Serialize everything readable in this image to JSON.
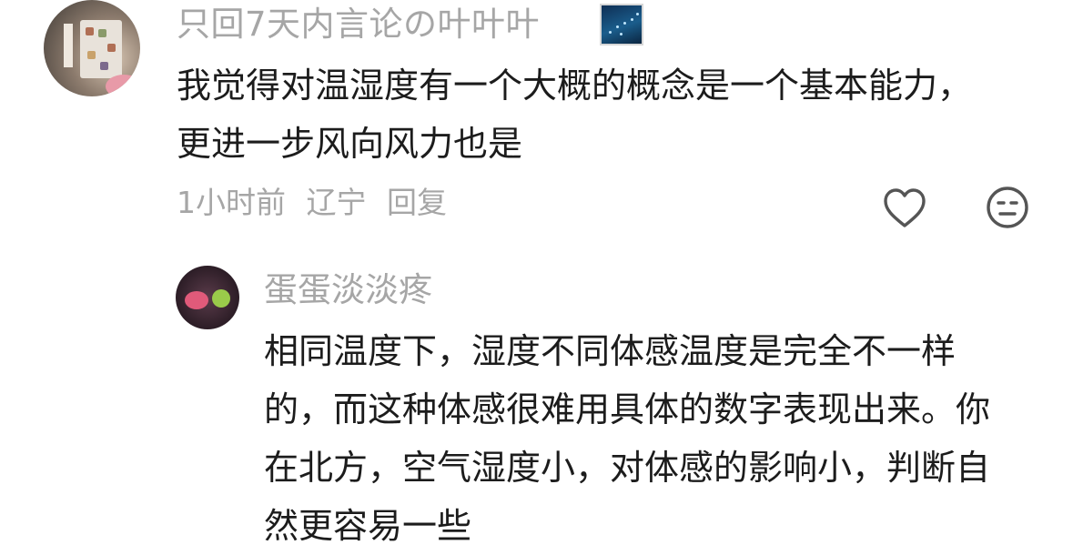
{
  "comment": {
    "username": "只回7天内言论の叶叶叶",
    "text": "我觉得对温湿度有一个大概的概念是一个基本能力，更进一步风向风力也是",
    "time": "1小时前",
    "location": "辽宁",
    "reply_label": "回复",
    "like_icon": "heart-icon",
    "dislike_icon": "neutral-face-icon"
  },
  "reply": {
    "username": "蛋蛋淡淡疼",
    "text": "相同温度下，湿度不同体感温度是完全不一样的，而这种体感很难用具体的数字表现出来。你在北方，空气湿度小，对体感的影响小，判断自然更容易一些"
  },
  "colors": {
    "username": "#a6a6a6",
    "text": "#1c1c1c",
    "icon": "#555555"
  }
}
